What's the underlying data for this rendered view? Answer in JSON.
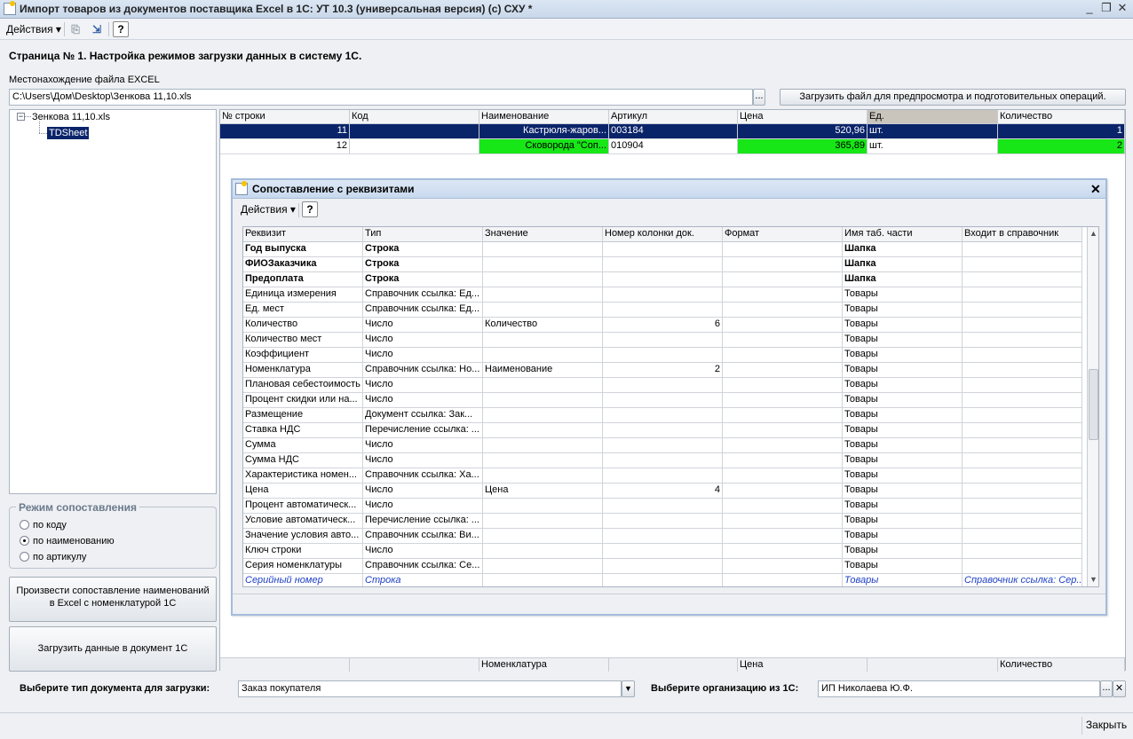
{
  "window": {
    "title": "Импорт товаров из документов поставщика Excel в 1С: УТ 10.3 (универсальная версия) (с) СХУ *"
  },
  "toolbar": {
    "actions_label": "Действия"
  },
  "page_heading": "Страница № 1. Настройка режимов загрузки данных в систему 1С.",
  "file": {
    "label": "Местонахождение файла EXCEL",
    "path": "C:\\Users\\Дом\\Desktop\\Зенкова 11,10.xls",
    "browse": "...",
    "load_button": "Загрузить файл для предпросмотра и подготовительных операций."
  },
  "tree": {
    "root": "Зенкова 11,10.xls",
    "sheet": "TDSheet"
  },
  "mode": {
    "title": "Режим сопоставления",
    "options": [
      "по коду",
      "по наименованию",
      "по артикулу"
    ],
    "selected": "по наименованию"
  },
  "actions": {
    "match_button": "Произвести сопоставление наименований в Excel с номенклатурой 1С",
    "load_button": "Загрузить данные в документ 1С"
  },
  "preview": {
    "columns": [
      "№ строки",
      "Код",
      "Наименование",
      "Артикул",
      "Цена",
      "Ед.",
      "Количество"
    ],
    "rows": [
      [
        "11",
        "",
        "Кастрюля-жаров...",
        "003184",
        "520,96",
        "шт.",
        "1"
      ],
      [
        "12",
        "",
        "Сковорода \"Соп...",
        "010904",
        "365,89",
        "шт.",
        "2"
      ]
    ],
    "footer": [
      "",
      "",
      "Номенклатура",
      "",
      "Цена",
      "",
      "Количество"
    ]
  },
  "dialog": {
    "title": "Сопоставление с реквизитами",
    "actions_label": "Действия",
    "columns": [
      "Реквизит",
      "Тип",
      "Значение",
      "Номер колонки док.",
      "Формат",
      "Имя таб. части",
      "Входит в справочник"
    ],
    "rows": [
      [
        "Год выпуска",
        "Строка",
        "",
        "",
        "",
        "Шапка",
        ""
      ],
      [
        "ФИОЗаказчика",
        "Строка",
        "",
        "",
        "",
        "Шапка",
        ""
      ],
      [
        "Предоплата",
        "Строка",
        "",
        "",
        "",
        "Шапка",
        ""
      ],
      [
        "Единица измерения",
        "Справочник ссылка: Ед...",
        "",
        "",
        "",
        "Товары",
        ""
      ],
      [
        "Ед. мест",
        "Справочник ссылка: Ед...",
        "",
        "",
        "",
        "Товары",
        ""
      ],
      [
        "Количество",
        "Число",
        "Количество",
        "6",
        "",
        "Товары",
        ""
      ],
      [
        "Количество мест",
        "Число",
        "",
        "",
        "",
        "Товары",
        ""
      ],
      [
        "Коэффициент",
        "Число",
        "",
        "",
        "",
        "Товары",
        ""
      ],
      [
        "Номенклатура",
        "Справочник ссылка: Но...",
        "Наименование",
        "2",
        "",
        "Товары",
        ""
      ],
      [
        "Плановая себестоимость",
        "Число",
        "",
        "",
        "",
        "Товары",
        ""
      ],
      [
        "Процент скидки или на...",
        "Число",
        "",
        "",
        "",
        "Товары",
        ""
      ],
      [
        "Размещение",
        "Документ ссылка: Зак...",
        "",
        "",
        "",
        "Товары",
        ""
      ],
      [
        "Ставка НДС",
        "Перечисление ссылка: ...",
        "",
        "",
        "",
        "Товары",
        ""
      ],
      [
        "Сумма",
        "Число",
        "",
        "",
        "",
        "Товары",
        ""
      ],
      [
        "Сумма НДС",
        "Число",
        "",
        "",
        "",
        "Товары",
        ""
      ],
      [
        "Характеристика номен...",
        "Справочник ссылка: Ха...",
        "",
        "",
        "",
        "Товары",
        ""
      ],
      [
        "Цена",
        "Число",
        "Цена",
        "4",
        "",
        "Товары",
        ""
      ],
      [
        "Процент автоматическ...",
        "Число",
        "",
        "",
        "",
        "Товары",
        ""
      ],
      [
        "Условие автоматическ...",
        "Перечисление ссылка: ...",
        "",
        "",
        "",
        "Товары",
        ""
      ],
      [
        "Значение условия авто...",
        "Справочник ссылка: Ви...",
        "",
        "",
        "",
        "Товары",
        ""
      ],
      [
        "Ключ строки",
        "Число",
        "",
        "",
        "",
        "Товары",
        ""
      ],
      [
        "Серия номенклатуры",
        "Справочник ссылка: Се...",
        "",
        "",
        "",
        "Товары",
        ""
      ],
      [
        "Серийный номер",
        "Строка",
        "",
        "",
        "",
        "Товары",
        "Справочник ссылка: Сер..."
      ]
    ]
  },
  "bottom": {
    "doc_type_label": "Выберите тип документа для загрузки:",
    "doc_type_value": "Заказ покупателя",
    "org_label": "Выберите организацию из 1С:",
    "org_value": "ИП Николаева Ю.Ф."
  },
  "status": {
    "close_button": "Закрыть"
  }
}
